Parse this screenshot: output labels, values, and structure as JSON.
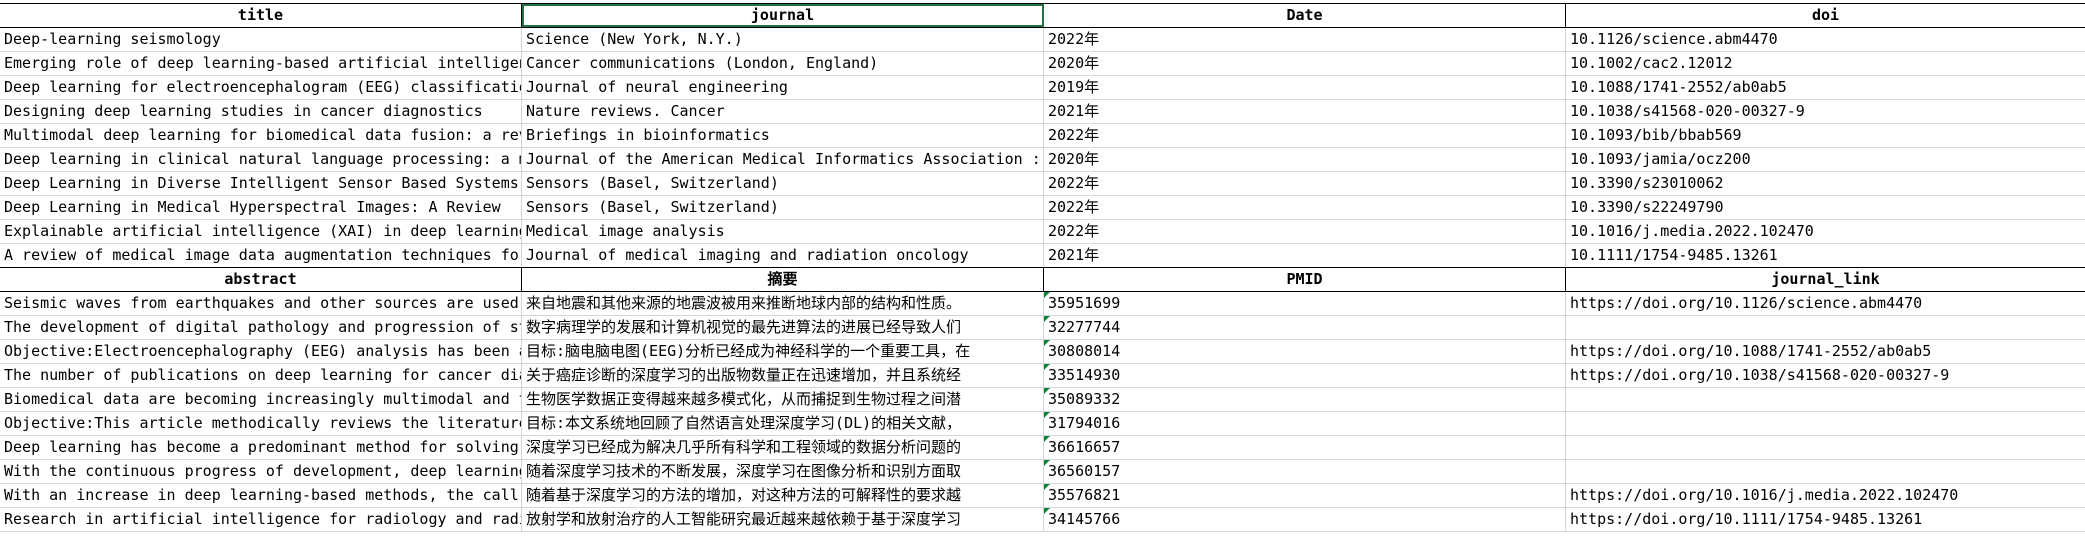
{
  "sheet1": {
    "headers": [
      "title",
      "journal",
      "Date",
      "doi"
    ],
    "rows": [
      [
        "Deep-learning seismology",
        "Science (New York, N.Y.)",
        "2022年",
        "10.1126/science.abm4470"
      ],
      [
        "Emerging role of deep learning-based artificial intelligence",
        "Cancer communications (London, England)",
        "2020年",
        "10.1002/cac2.12012"
      ],
      [
        "Deep learning for electroencephalogram (EEG) classification",
        "Journal of neural engineering",
        "2019年",
        "10.1088/1741-2552/ab0ab5"
      ],
      [
        "Designing deep learning studies in cancer diagnostics",
        "Nature reviews. Cancer",
        "2021年",
        "10.1038/s41568-020-00327-9"
      ],
      [
        "Multimodal deep learning for biomedical data fusion: a review",
        "Briefings in bioinformatics",
        "2022年",
        "10.1093/bib/bbab569"
      ],
      [
        "Deep learning in clinical natural language processing: a methodical review",
        "Journal of the American Medical Informatics Association : JAMIA",
        "2020年",
        "10.1093/jamia/ocz200"
      ],
      [
        "Deep Learning in Diverse Intelligent Sensor Based Systems",
        "Sensors (Basel, Switzerland)",
        "2022年",
        "10.3390/s23010062"
      ],
      [
        "Deep Learning in Medical Hyperspectral Images: A Review",
        "Sensors (Basel, Switzerland)",
        "2022年",
        "10.3390/s22249790"
      ],
      [
        "Explainable artificial intelligence (XAI) in deep learning",
        "Medical image analysis",
        "2022年",
        "10.1016/j.media.2022.102470"
      ],
      [
        "A review of medical image data augmentation techniques for deep learning",
        "Journal of medical imaging and radiation oncology",
        "2021年",
        "10.1111/1754-9485.13261"
      ]
    ]
  },
  "sheet2": {
    "headers": [
      "abstract",
      "摘要",
      "PMID",
      "journal_link"
    ],
    "rows": [
      [
        "Seismic waves from earthquakes and other sources are used to infer",
        "来自地震和其他来源的地震波被用来推断地球内部的结构和性质。",
        "35951699",
        "https://doi.org/10.1126/science.abm4470"
      ],
      [
        "The development of digital pathology and progression of state-of-the-art",
        "数字病理学的发展和计算机视觉的最先进算法的进展已经导致人们",
        "32277744",
        ""
      ],
      [
        "Objective:Electroencephalography (EEG) analysis has been an important",
        "目标:脑电脑电图(EEG)分析已经成为神经科学的一个重要工具，在",
        "30808014",
        "https://doi.org/10.1088/1741-2552/ab0ab5"
      ],
      [
        "The number of publications on deep learning for cancer diagnostics",
        "关于癌症诊断的深度学习的出版物数量正在迅速增加，并且系统经",
        "33514930",
        "https://doi.org/10.1038/s41568-020-00327-9"
      ],
      [
        "Biomedical data are becoming increasingly multimodal and thereby",
        "生物医学数据正变得越来越多模式化，从而捕捉到生物过程之间潜",
        "35089332",
        ""
      ],
      [
        "Objective:This article methodically reviews the literature on deep",
        "目标:本文系统地回顾了自然语言处理深度学习(DL)的相关文献，",
        "31794016",
        ""
      ],
      [
        "Deep learning has become a predominant method for solving data analysis",
        "深度学习已经成为解决几乎所有科学和工程领域的数据分析问题的",
        "36616657",
        ""
      ],
      [
        "With the continuous progress of development, deep learning has",
        "随着深度学习技术的不断发展，深度学习在图像分析和识别方面取",
        "36560157",
        ""
      ],
      [
        "With an increase in deep learning-based methods, the call for",
        "随着基于深度学习的方法的增加，对这种方法的可解释性的要求越",
        "35576821",
        "https://doi.org/10.1016/j.media.2022.102470"
      ],
      [
        "Research in artificial intelligence for radiology and radiotherapy",
        "放射学和放射治疗的人工智能研究最近越来越依赖于基于深度学习",
        "34145766",
        "https://doi.org/10.1111/1754-9485.13261"
      ]
    ]
  }
}
